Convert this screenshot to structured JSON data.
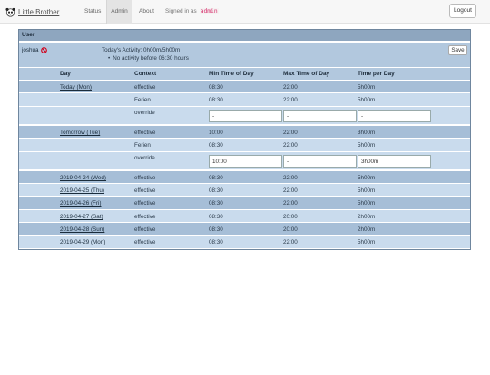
{
  "nav": {
    "brand": "Little Brother",
    "links": [
      "Status",
      "Admin",
      "About"
    ],
    "signed_in_label": "Signed in as",
    "signed_in_user": "admin",
    "logout": "Logout"
  },
  "panel": {
    "title": "User",
    "user": "joshua",
    "activity": "Today's Activity: 0h00m/5h00m",
    "activity_note": "No activity before 06:30 hours",
    "save": "Save"
  },
  "table": {
    "headers": [
      "Day",
      "Context",
      "Min Time of Day",
      "Max Time of Day",
      "Time per Day"
    ],
    "rows": [
      {
        "day": "Today (Mon)",
        "context": "effective",
        "min": "08:30",
        "max": "22:00",
        "time": "5h00m"
      },
      {
        "day": "",
        "context": "Ferien",
        "min": "08:30",
        "max": "22:00",
        "time": "5h00m"
      },
      {
        "day": "",
        "context": "override",
        "min": "-",
        "max": "-",
        "time": "-"
      },
      {
        "day": "Tomorrow (Tue)",
        "context": "effective",
        "min": "10:00",
        "max": "22:00",
        "time": "3h00m"
      },
      {
        "day": "",
        "context": "Ferien",
        "min": "08:30",
        "max": "22:00",
        "time": "5h00m"
      },
      {
        "day": "",
        "context": "override",
        "min": "10:00",
        "max": "-",
        "time": "3h00m"
      },
      {
        "day": "2019-04-24 (Wed)",
        "context": "effective",
        "min": "08:30",
        "max": "22:00",
        "time": "5h00m"
      },
      {
        "day": "2019-04-25 (Thu)",
        "context": "effective",
        "min": "08:30",
        "max": "22:00",
        "time": "5h00m"
      },
      {
        "day": "2019-04-26 (Fri)",
        "context": "effective",
        "min": "08:30",
        "max": "22:00",
        "time": "5h00m"
      },
      {
        "day": "2019-04-27 (Sat)",
        "context": "effective",
        "min": "08:30",
        "max": "20:00",
        "time": "2h00m"
      },
      {
        "day": "2019-04-28 (Sun)",
        "context": "effective",
        "min": "08:30",
        "max": "20:00",
        "time": "2h00m"
      },
      {
        "day": "2019-04-29 (Mon)",
        "context": "effective",
        "min": "08:30",
        "max": "22:00",
        "time": "5h00m"
      }
    ]
  }
}
